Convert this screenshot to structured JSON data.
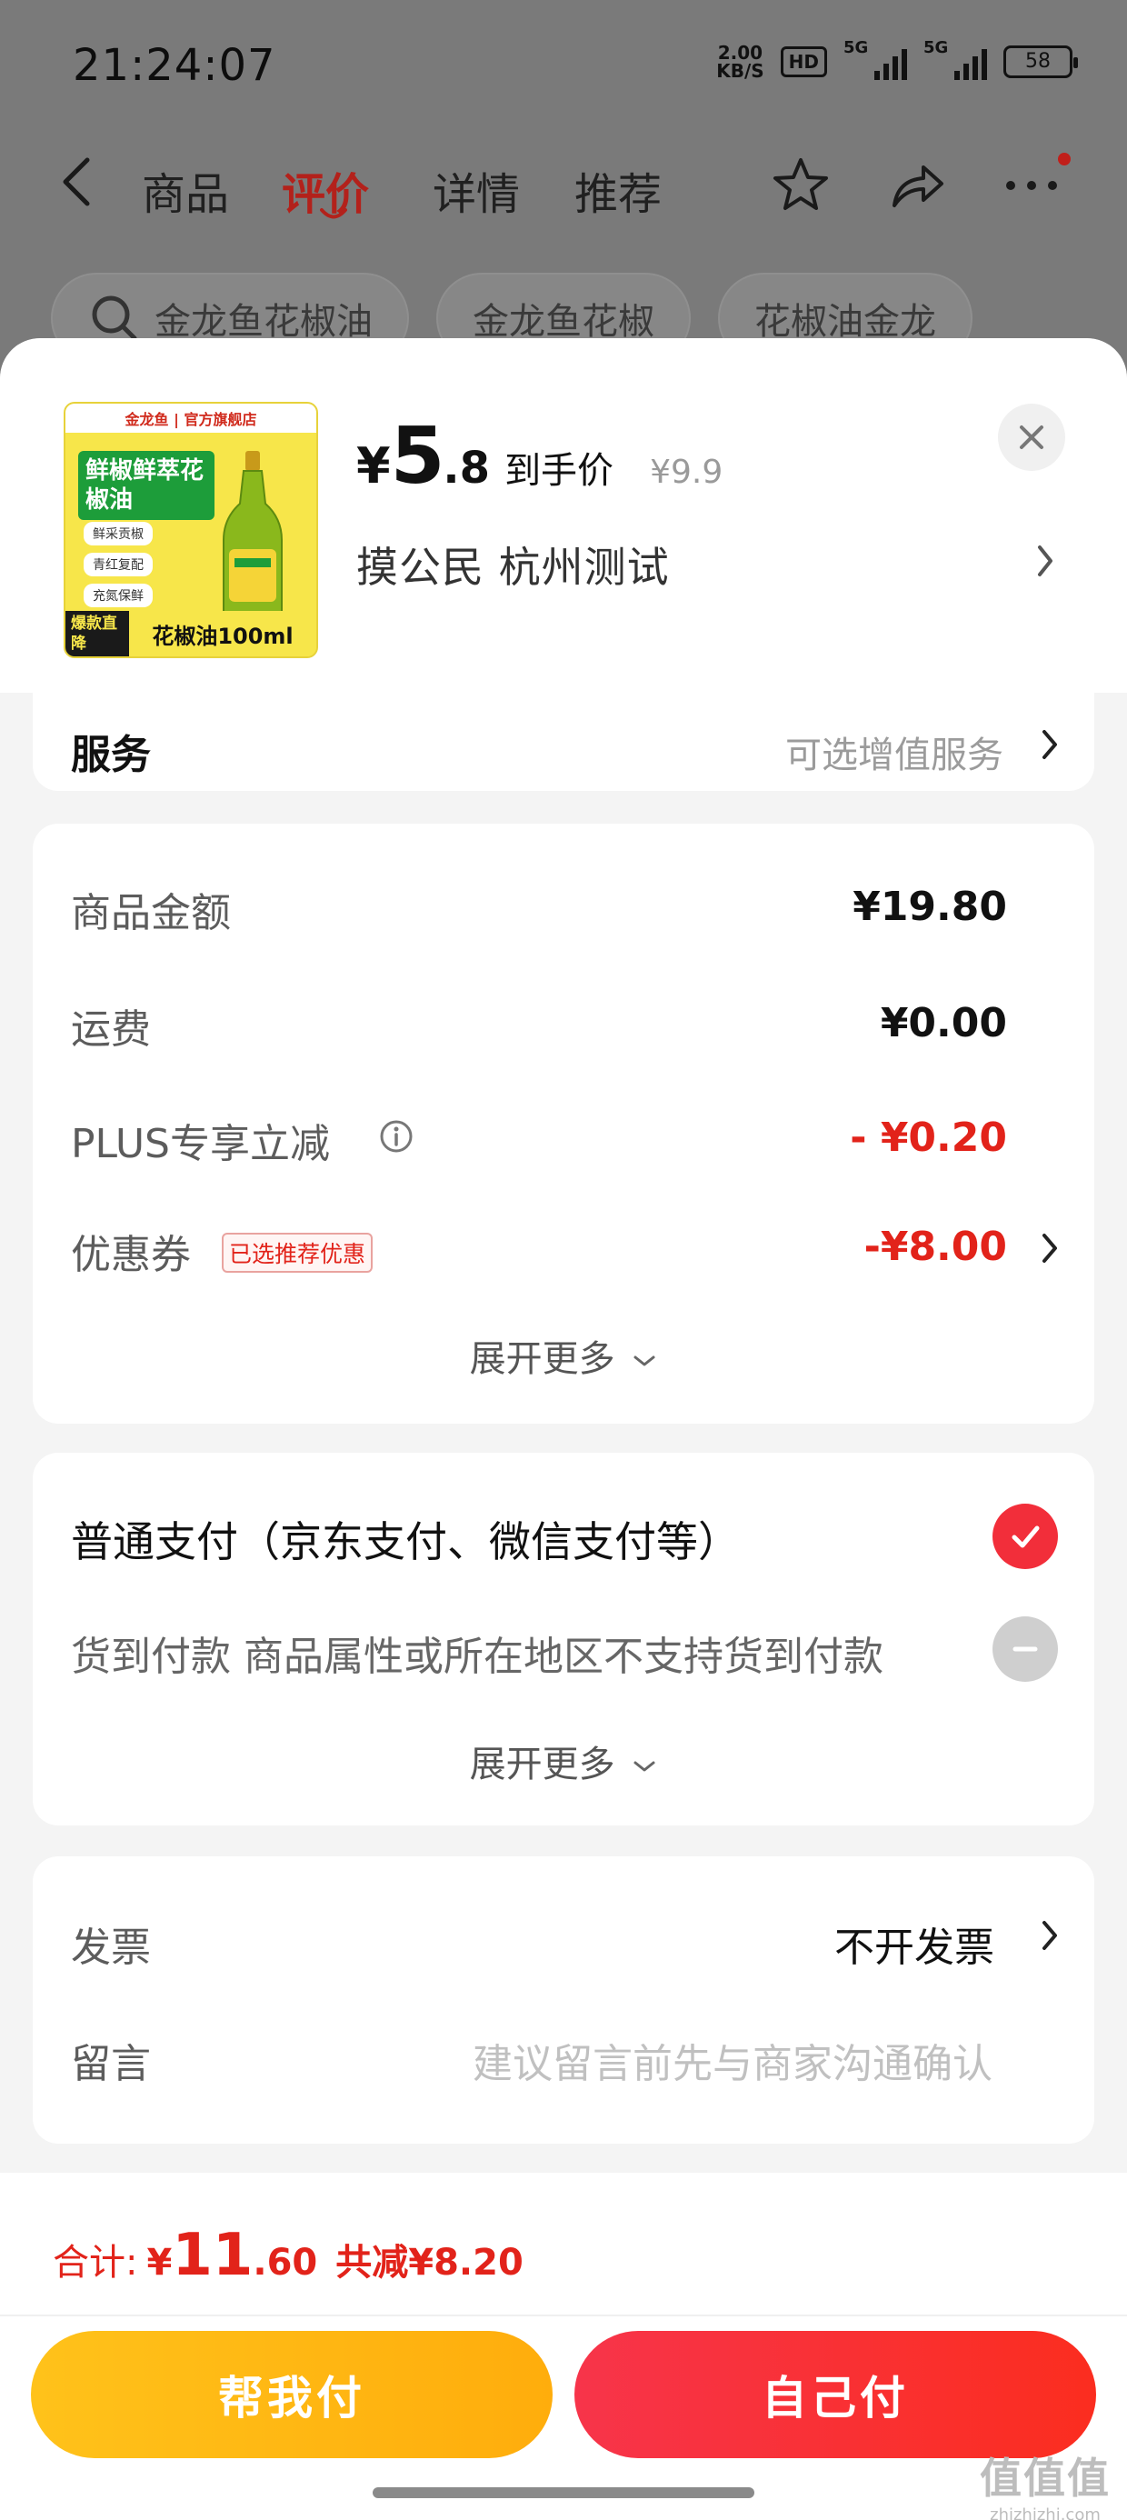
{
  "status_bar": {
    "time": "21:24:07",
    "net_speed_value": "2.00",
    "net_speed_unit": "KB/S",
    "hd_label": "HD",
    "signal_1": "5G",
    "signal_2": "5G",
    "battery": "58"
  },
  "nav": {
    "tabs": [
      "商品",
      "评价",
      "详情",
      "推荐"
    ],
    "active_tab": "评价"
  },
  "search_chips": [
    "金龙鱼花椒油",
    "金龙鱼花椒",
    "花椒油金龙"
  ],
  "product": {
    "image_store_label": "金龙鱼 | 官方旗舰店",
    "image_title": "鲜椒鲜萃花椒油",
    "image_tags": [
      "鲜采贡椒",
      "青红复配",
      "充氮保鲜"
    ],
    "image_badge": "爆款直降",
    "image_spec": "花椒油100ml",
    "price_currency": "¥",
    "price_int": "5",
    "price_dec": ".8",
    "price_label": "到手价",
    "original_price": "¥9.9",
    "address": "摸公民  杭州测试"
  },
  "service": {
    "title": "服务",
    "option": "可选增值服务"
  },
  "amounts": {
    "goods_label": "商品金额",
    "goods_value": "¥19.80",
    "shipping_label": "运费",
    "shipping_value": "¥0.00",
    "plus_label": "PLUS专享立减",
    "plus_value": "- ¥0.20",
    "coupon_label": "优惠券",
    "coupon_tag": "已选推荐优惠",
    "coupon_value": "-¥8.00",
    "expand": "展开更多"
  },
  "payment": {
    "normal": "普通支付（京东支付、微信支付等）",
    "cod": "货到付款 商品属性或所在地区不支持货到付款",
    "expand": "展开更多"
  },
  "invoice": {
    "label": "发票",
    "value": "不开发票",
    "note_label": "留言",
    "note_placeholder": "建议留言前先与商家沟通确认"
  },
  "footer": {
    "total_label": "合计:",
    "total_currency": "¥",
    "total_int": "11",
    "total_dec": ".60",
    "total_saving": "共减¥8.20",
    "help_pay": "帮我付",
    "self_pay": "自己付"
  },
  "watermark": {
    "logo": "值值值",
    "url": "zhizhizhi.com"
  },
  "colors": {
    "accent_red": "#e2231a",
    "help_button": "#ffb714",
    "self_button": "#f8313a"
  }
}
